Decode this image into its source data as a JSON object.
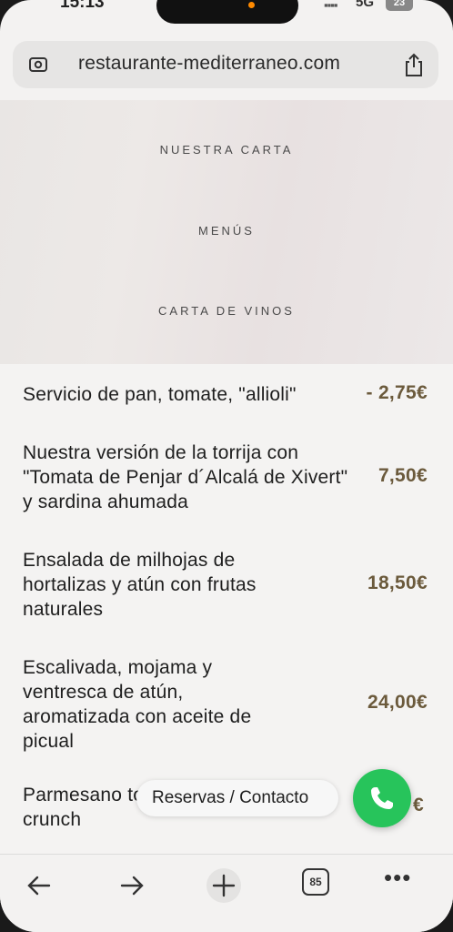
{
  "status": {
    "time": "15:13",
    "network": "5G",
    "battery": "23",
    "signal": "▪▪▪▪"
  },
  "browser": {
    "url": "restaurante-mediterraneo.com",
    "tab_count": "85"
  },
  "nav": {
    "links": [
      "NUESTRA CARTA",
      "MENÚS",
      "CARTA DE VINOS"
    ]
  },
  "menu": {
    "items": [
      {
        "name": "Servicio de pan, tomate, \"allioli\"",
        "price": "- 2,75€"
      },
      {
        "name": "Nuestra versión de la torrija con \"Tomata de Penjar d´Alcalá de Xivert\" y sardina ahumada",
        "price": "7,50€"
      },
      {
        "name": "Ensalada de milhojas de hortalizas y atún con frutas naturales",
        "price": "18,50€"
      },
      {
        "name": "Escalivada, mojama y ventresca de atún, aromatizada con aceite de picual",
        "price": "24,00€"
      },
      {
        "name": "Parmesano tostado y frambuesa crunch",
        "price": "€"
      }
    ]
  },
  "floating": {
    "reservas_label": "Reservas / Contacto"
  },
  "colors": {
    "call_green": "#27c45b",
    "price_brown": "#6b5a3c"
  }
}
